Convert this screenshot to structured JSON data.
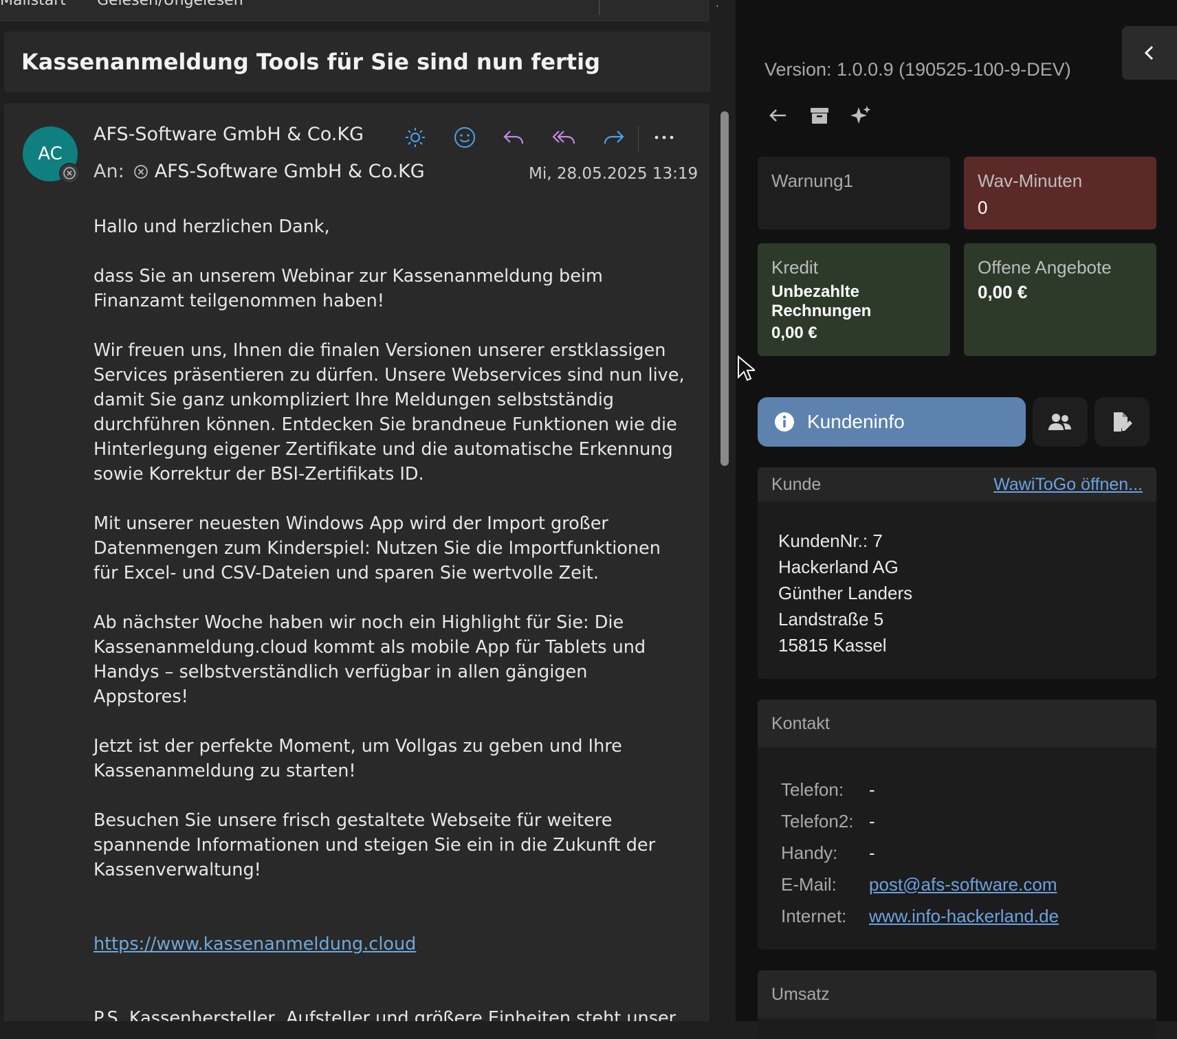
{
  "toolbar": {
    "clipped_items": [
      "Mailstart",
      "Gelesen/Ungelesen"
    ]
  },
  "message": {
    "subject": "Kassenanmeldung Tools für Sie sind nun fertig",
    "avatar_initials": "AC",
    "sender": "AFS-Software GmbH & Co.KG",
    "to_label": "An:",
    "to": "AFS-Software GmbH & Co.KG",
    "date": "Mi, 28.05.2025 13:19",
    "body": {
      "p1": "Hallo und herzlichen Dank,",
      "p2": "dass Sie an unserem Webinar zur Kassenanmeldung beim Finanzamt teilgenommen haben!",
      "p3": "Wir freuen uns, Ihnen die finalen Versionen unserer erstklassigen Services präsentieren zu dürfen. Unsere Webservices sind nun live, damit Sie ganz unkompliziert Ihre Meldungen selbstständig durchführen können. Entdecken Sie brandneue Funktionen wie die Hinterlegung eigener Zertifikate und die automatische Erkennung sowie Korrektur der BSI-Zertifikats ID.",
      "p4": "Mit unserer neuesten Windows App wird der Import großer Datenmengen zum Kinderspiel: Nutzen Sie die Importfunktionen für Excel- und CSV-Dateien und sparen Sie wertvolle Zeit.",
      "p5": "Ab nächster Woche haben wir noch ein Highlight für Sie: Die Kassenanmeldung.cloud kommt als mobile App für Tablets und Handys – selbstverständlich verfügbar in allen gängigen Appstores!",
      "p6": "Jetzt ist der perfekte Moment, um Vollgas zu geben und Ihre Kassenanmeldung zu starten!",
      "p7": "Besuchen Sie unsere frisch gestaltete Webseite für weitere spannende Informationen und steigen Sie ein in die Zukunft der Kassenverwaltung!",
      "link": "https://www.kassenanmeldung.cloud",
      "p8": "P.S. Kassenhersteller, Aufsteller und größere Einheiten steht unser"
    }
  },
  "panel": {
    "version": "Version: 1.0.0.9 (190525-100-9-DEV)",
    "tiles": {
      "warnung_title": "Warnung1",
      "wav_title": "Wav-Minuten",
      "wav_value": "0",
      "kredit_title": "Kredit",
      "kredit_sub": "Unbezahlte Rechnungen",
      "kredit_value": "0,00 €",
      "offen_title": "Offene Angebote",
      "offen_value": "0,00 €"
    },
    "kundeninfo_label": "Kundeninfo",
    "kunde": {
      "header": "Kunde",
      "link": "WawiToGo öffnen...",
      "lines": [
        "KundenNr.: 7",
        "Hackerland AG",
        "Günther Landers",
        "Landstraße 5",
        "15815 Kassel"
      ]
    },
    "kontakt": {
      "header": "Kontakt",
      "rows": [
        {
          "label": "Telefon:",
          "value": "-"
        },
        {
          "label": "Telefon2:",
          "value": "-"
        },
        {
          "label": "Handy:",
          "value": "-"
        },
        {
          "label": "E-Mail:",
          "value": "post@afs-software.com"
        },
        {
          "label": "Internet:",
          "value": "www.info-hackerland.de"
        }
      ]
    },
    "umsatz_header": "Umsatz"
  },
  "colors": {
    "accent_blue": "#5d82ae",
    "tile_red": "#5b2a28",
    "tile_green": "#2d3a2a",
    "link": "#6aa3e0",
    "avatar": "#0f7f80",
    "reply_purple": "#c48be8",
    "forward_blue": "#4aa3f0"
  },
  "icons": [
    "chevron-down-icon",
    "sun-icon",
    "emoji-icon",
    "reply-icon",
    "reply-all-icon",
    "forward-icon",
    "more-icon",
    "remove-icon",
    "back-arrow-icon",
    "archive-icon",
    "sparkle-icon",
    "chevron-left-icon",
    "info-icon",
    "people-icon",
    "document-edit-icon",
    "mouse-cursor-icon"
  ]
}
